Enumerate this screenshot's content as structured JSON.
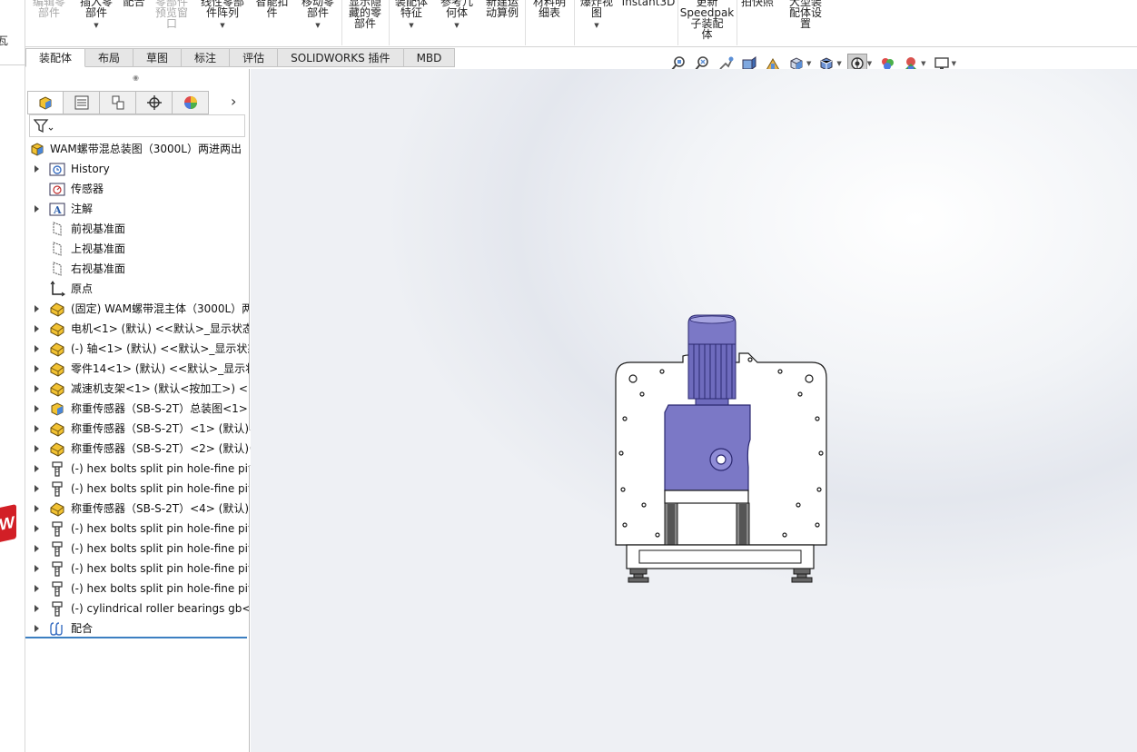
{
  "left_strip": {
    "char": "瓦",
    "logo_text": "W"
  },
  "ribbon": {
    "buttons": [
      {
        "label": "编辑零\n部件",
        "grey": true,
        "caret": false
      },
      {
        "label": "插入零\n部件",
        "grey": false,
        "caret": true
      },
      {
        "label": "配合",
        "grey": false,
        "caret": false
      },
      {
        "label": "零部件\n预览窗\n口",
        "grey": true,
        "caret": false
      },
      {
        "label": "线性零部\n件阵列",
        "grey": false,
        "caret": true
      },
      {
        "label": "智能扣\n件",
        "grey": false,
        "caret": false
      },
      {
        "label": "移动零\n部件",
        "grey": false,
        "caret": true
      },
      {
        "label": "显示隐\n藏的零\n部件",
        "grey": false,
        "caret": false
      },
      {
        "label": "装配体\n特征",
        "grey": false,
        "caret": true
      },
      {
        "label": "参考几\n何体",
        "grey": false,
        "caret": true
      },
      {
        "label": "新建运\n动算例",
        "grey": false,
        "caret": false
      },
      {
        "label": "材料明\n细表",
        "grey": false,
        "caret": false
      },
      {
        "label": "爆炸视\n图",
        "grey": false,
        "caret": true
      },
      {
        "label": "Instant3D",
        "grey": false,
        "caret": false
      },
      {
        "label": "更新\nSpeedpak\n子装配\n体",
        "grey": false,
        "caret": false
      },
      {
        "label": "拍快照",
        "grey": false,
        "caret": false
      },
      {
        "label": "大型装\n配体设\n置",
        "grey": false,
        "caret": false
      }
    ]
  },
  "tabs": [
    {
      "label": "装配体",
      "active": true
    },
    {
      "label": "布局",
      "active": false
    },
    {
      "label": "草图",
      "active": false
    },
    {
      "label": "标注",
      "active": false
    },
    {
      "label": "评估",
      "active": false
    },
    {
      "label": "SOLIDWORKS 插件",
      "active": false
    },
    {
      "label": "MBD",
      "active": false
    }
  ],
  "view_toolbar": {
    "icons": [
      "zoom-to-fit-icon",
      "zoom-to-area-icon",
      "previous-view-icon",
      "section-view-icon",
      "dynamic-annotation-icon",
      "view-orientation-icon",
      "display-style-icon",
      "hide-show-items-icon",
      "edit-appearance-icon",
      "apply-scene-icon",
      "view-settings-icon"
    ]
  },
  "tree": {
    "root": "WAM螺带混总装图（3000L）两进两出（",
    "items": [
      {
        "label": "History",
        "icon": "history",
        "arrow": true
      },
      {
        "label": "传感器",
        "icon": "sensor",
        "arrow": false
      },
      {
        "label": "注解",
        "icon": "annotation",
        "arrow": true
      },
      {
        "label": "前视基准面",
        "icon": "plane",
        "arrow": false
      },
      {
        "label": "上视基准面",
        "icon": "plane",
        "arrow": false
      },
      {
        "label": "右视基准面",
        "icon": "plane",
        "arrow": false
      },
      {
        "label": "原点",
        "icon": "origin",
        "arrow": false
      },
      {
        "label": "(固定) WAM螺带混主体（3000L）两",
        "icon": "part",
        "arrow": true
      },
      {
        "label": "电机<1> (默认) <<默认>_显示状态",
        "icon": "part",
        "arrow": true
      },
      {
        "label": "(-) 轴<1> (默认) <<默认>_显示状态",
        "icon": "part",
        "arrow": true
      },
      {
        "label": "零件14<1> (默认) <<默认>_显示状",
        "icon": "part",
        "arrow": true
      },
      {
        "label": "减速机支架<1> (默认<按加工>) <<",
        "icon": "part",
        "arrow": true
      },
      {
        "label": "称重传感器（SB-S-2T）总装图<1>",
        "icon": "assembly",
        "arrow": true
      },
      {
        "label": "称重传感器（SB-S-2T）<1> (默认)",
        "icon": "part",
        "arrow": true
      },
      {
        "label": "称重传感器（SB-S-2T）<2> (默认)",
        "icon": "part",
        "arrow": true
      },
      {
        "label": "(-) hex bolts split pin hole-fine pit",
        "icon": "bolt",
        "arrow": true
      },
      {
        "label": "(-) hex bolts split pin hole-fine pit",
        "icon": "bolt",
        "arrow": true
      },
      {
        "label": "称重传感器（SB-S-2T）<4> (默认)",
        "icon": "part",
        "arrow": true
      },
      {
        "label": "(-) hex bolts split pin hole-fine pit",
        "icon": "bolt",
        "arrow": true
      },
      {
        "label": "(-) hex bolts split pin hole-fine pit",
        "icon": "bolt",
        "arrow": true
      },
      {
        "label": "(-) hex bolts split pin hole-fine pit",
        "icon": "bolt",
        "arrow": true
      },
      {
        "label": "(-) hex bolts split pin hole-fine pit",
        "icon": "bolt",
        "arrow": true
      },
      {
        "label": "(-) cylindrical roller bearings gb<",
        "icon": "bolt",
        "arrow": true
      },
      {
        "label": "配合",
        "icon": "mates",
        "arrow": true
      }
    ]
  },
  "colors": {
    "motor": "#7b78c6",
    "motor_dark": "#3f3c8c",
    "tab_active_bg": "#ffffff",
    "tree_end_line": "#3c7fc1"
  }
}
